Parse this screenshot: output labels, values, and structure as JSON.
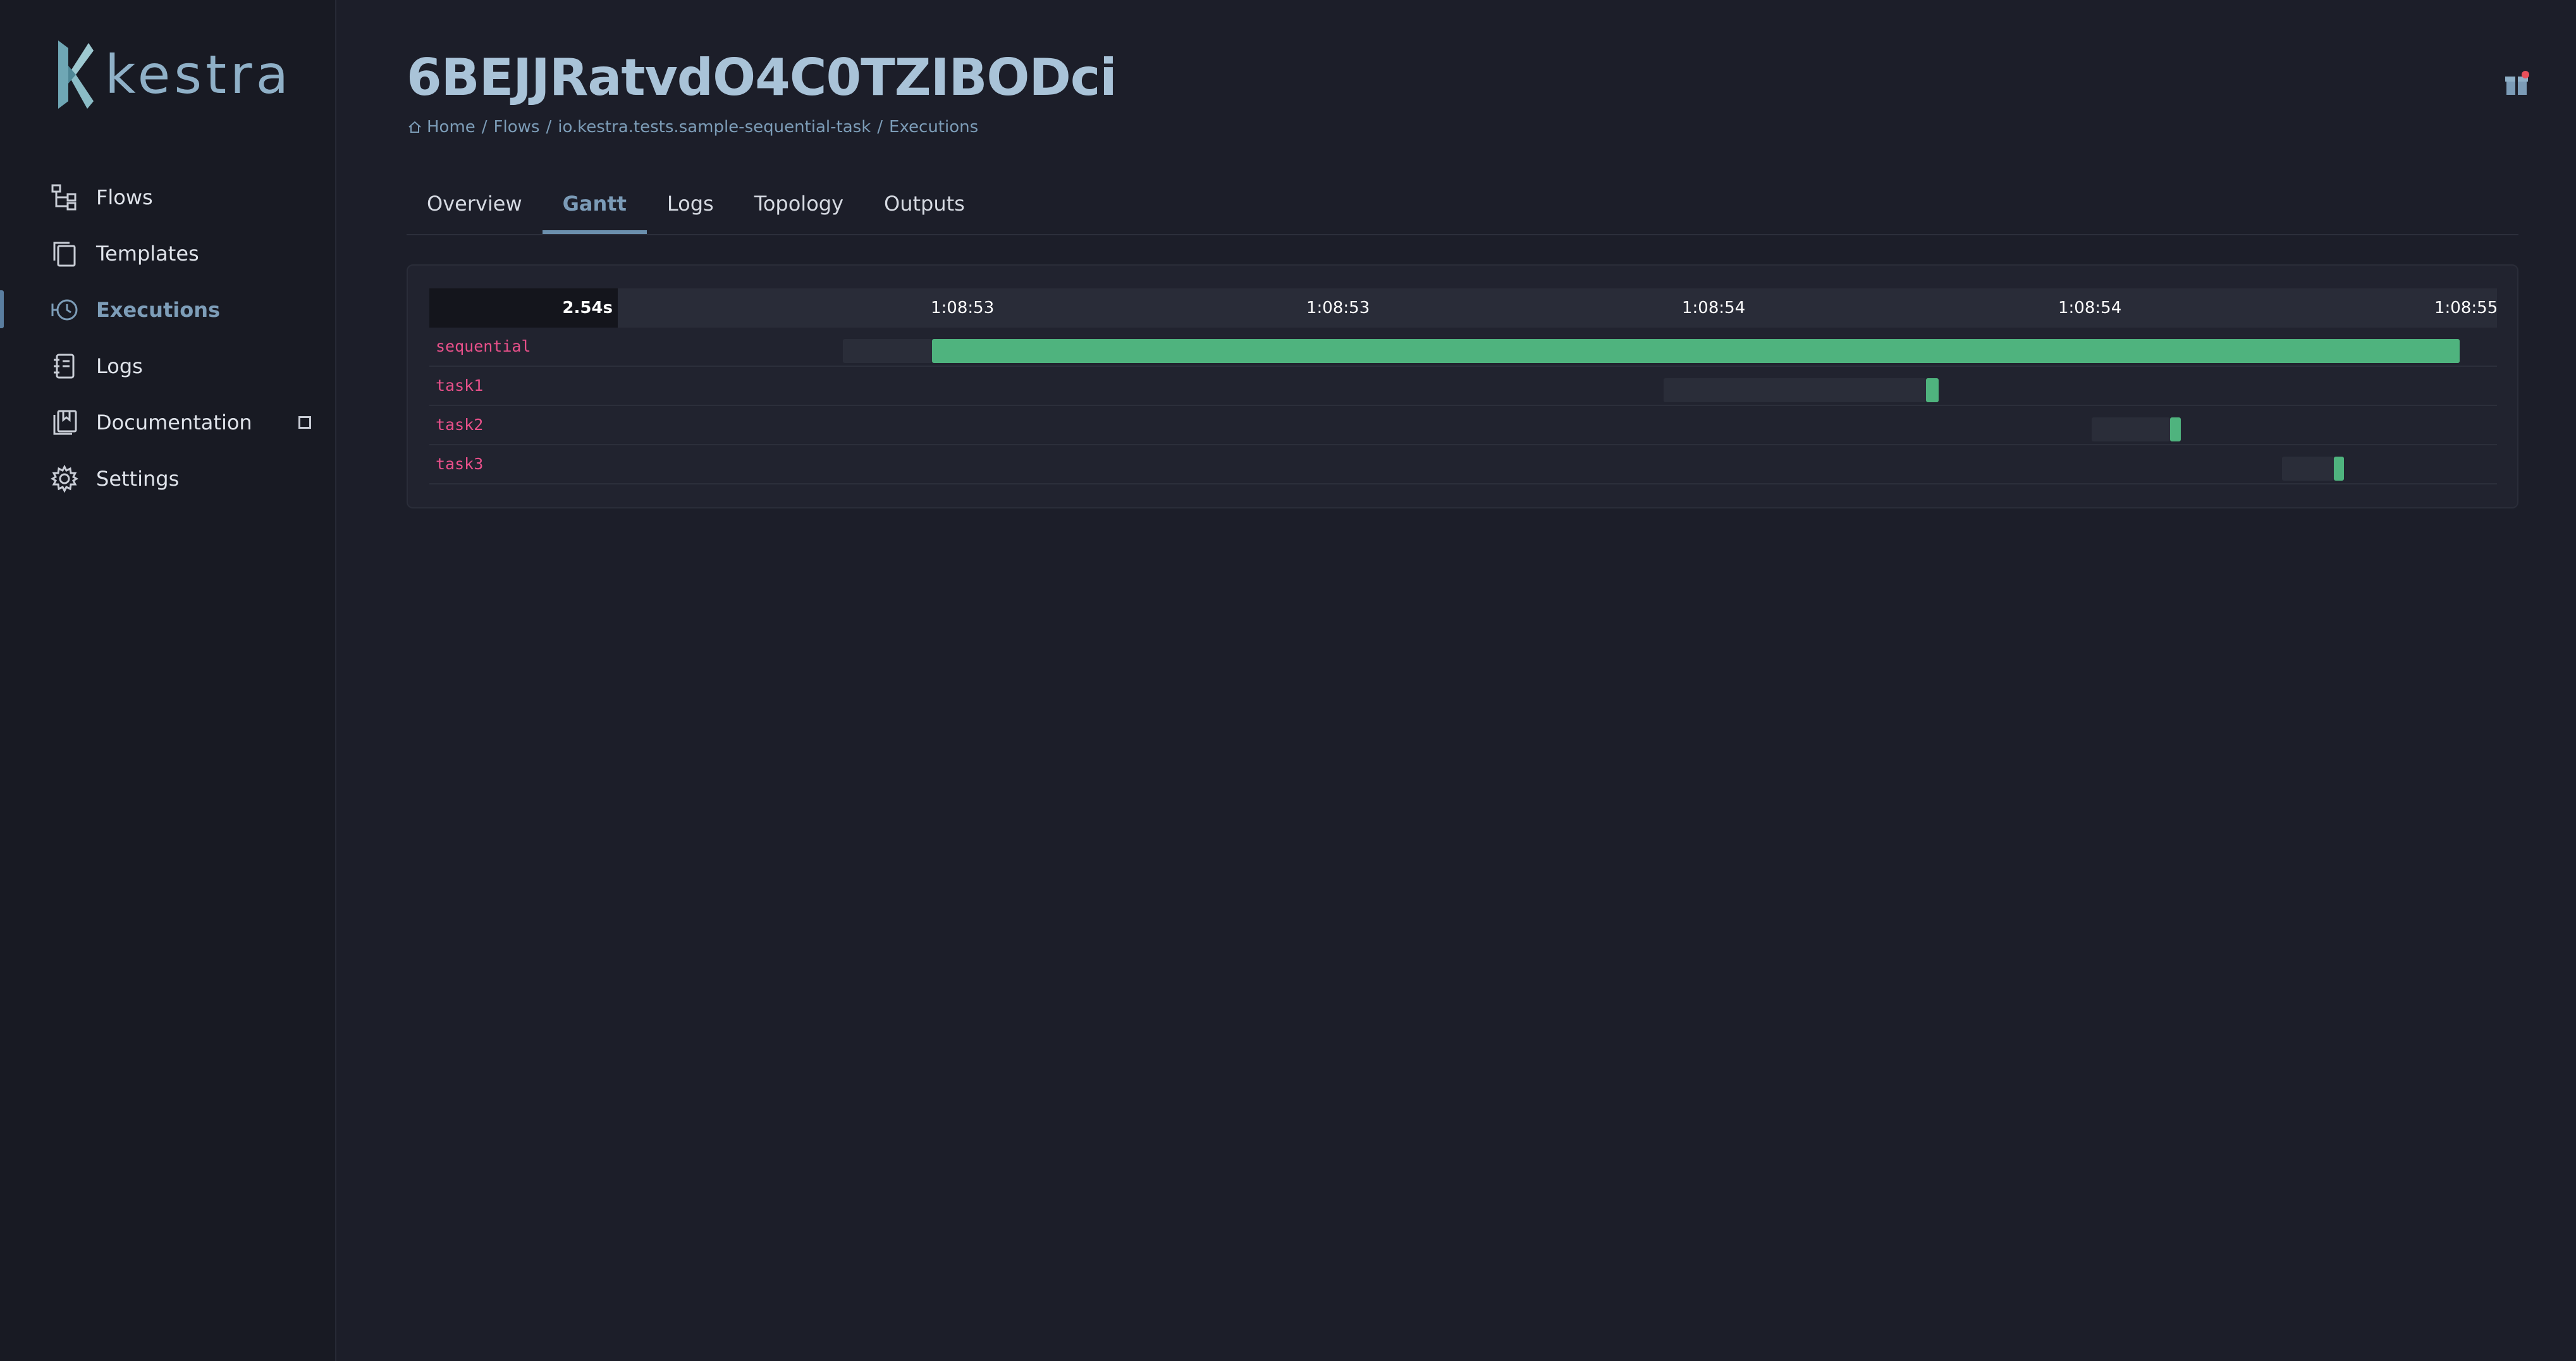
{
  "app": {
    "logo_text": "kestra",
    "brand_color": "#8fb0c7",
    "accent_color": "#6b8fad",
    "success_color": "#4fb37e",
    "task_label_color": "#e8508a"
  },
  "sidebar": {
    "items": [
      {
        "label": "Flows",
        "icon": "flows-icon"
      },
      {
        "label": "Templates",
        "icon": "templates-icon"
      },
      {
        "label": "Executions",
        "icon": "executions-icon",
        "active": true
      },
      {
        "label": "Logs",
        "icon": "logs-icon"
      },
      {
        "label": "Documentation",
        "icon": "documentation-icon",
        "external": true
      },
      {
        "label": "Settings",
        "icon": "gear-icon"
      }
    ]
  },
  "header": {
    "title": "6BEJJRatvdO4C0TZIBODci",
    "breadcrumb": [
      {
        "label": "Home",
        "icon": "home-icon"
      },
      {
        "label": "Flows"
      },
      {
        "label": "io.kestra.tests.sample-sequential-task"
      },
      {
        "label": "Executions"
      }
    ],
    "breadcrumb_separator": "/",
    "gift_icon": "gift-icon"
  },
  "tabs": [
    {
      "label": "Overview"
    },
    {
      "label": "Gantt",
      "active": true
    },
    {
      "label": "Logs"
    },
    {
      "label": "Topology"
    },
    {
      "label": "Outputs"
    }
  ],
  "gantt": {
    "total_duration": "2.54s",
    "ticks": [
      "1:08:53",
      "1:08:53",
      "1:08:54",
      "1:08:54",
      "1:08:55"
    ],
    "rows": [
      {
        "name": "sequential",
        "created_pct": 20.0,
        "start_pct": 24.3,
        "end_pct": 98.2
      },
      {
        "name": "task1",
        "created_pct": 59.7,
        "start_pct": 72.4,
        "end_pct": 73.0
      },
      {
        "name": "task2",
        "created_pct": 80.4,
        "start_pct": 84.2,
        "end_pct": 84.7
      },
      {
        "name": "task3",
        "created_pct": 89.6,
        "start_pct": 92.1,
        "end_pct": 92.6
      }
    ]
  }
}
